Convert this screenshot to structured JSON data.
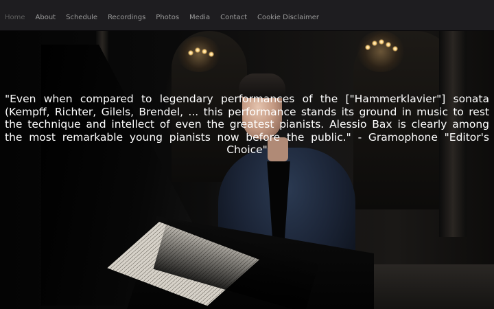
{
  "nav": {
    "items": [
      {
        "label": "Home",
        "active": true
      },
      {
        "label": "About",
        "active": false
      },
      {
        "label": "Schedule",
        "active": false
      },
      {
        "label": "Recordings",
        "active": false
      },
      {
        "label": "Photos",
        "active": false
      },
      {
        "label": "Media",
        "active": false
      },
      {
        "label": "Contact",
        "active": false
      },
      {
        "label": "Cookie Disclaimer",
        "active": false
      }
    ]
  },
  "hero": {
    "quote": "\"Even when compared to legendary performances of the [\"Hammerklavier\"] sonata (Kempff, Richter, Gilels, Brendel, ... this performance stands its ground in music to rest the technique and intellect of even the greatest pianists. Alessio Bax is clearly among the most remarkable young pianists now before the public.\" - Gramophone \"Editor's Choice\""
  },
  "colors": {
    "nav_bg": "#1e1d20",
    "nav_text": "#9b9b9b",
    "nav_active_text": "#5f5f5f",
    "quote_text": "#ffffff"
  }
}
